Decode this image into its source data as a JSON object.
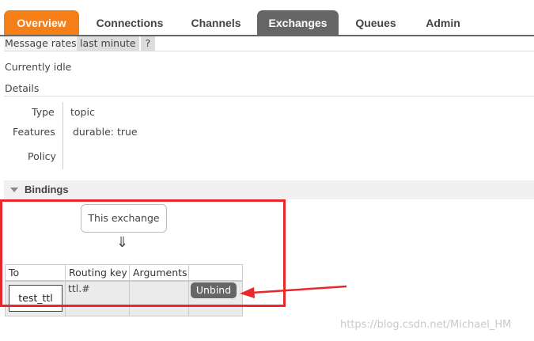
{
  "tabs": [
    {
      "label": "Overview"
    },
    {
      "label": "Connections"
    },
    {
      "label": "Channels"
    },
    {
      "label": "Exchanges"
    },
    {
      "label": "Queues"
    },
    {
      "label": "Admin"
    }
  ],
  "active_tab": "Exchanges",
  "message_rates": {
    "label": "Message rates",
    "range_button": "last minute",
    "help_button": "?"
  },
  "status": "Currently idle",
  "details": {
    "heading": "Details",
    "type_label": "Type",
    "type_value": "topic",
    "features_label": "Features",
    "features_key": "durable:",
    "features_value": "true",
    "policy_label": "Policy",
    "policy_value": ""
  },
  "bindings": {
    "heading": "Bindings",
    "this_exchange": "This exchange",
    "arrow": "⇓",
    "columns": [
      "To",
      "Routing key",
      "Arguments",
      ""
    ],
    "rows": [
      {
        "to": "test_ttl",
        "routing_key": "ttl.#",
        "arguments": "",
        "action": "Unbind"
      }
    ]
  },
  "watermark": "https://blog.csdn.net/Michael_HM",
  "colors": {
    "overview_tab": "#f47e18",
    "active_tab": "#666666",
    "annotation_red": "#e8282a"
  }
}
